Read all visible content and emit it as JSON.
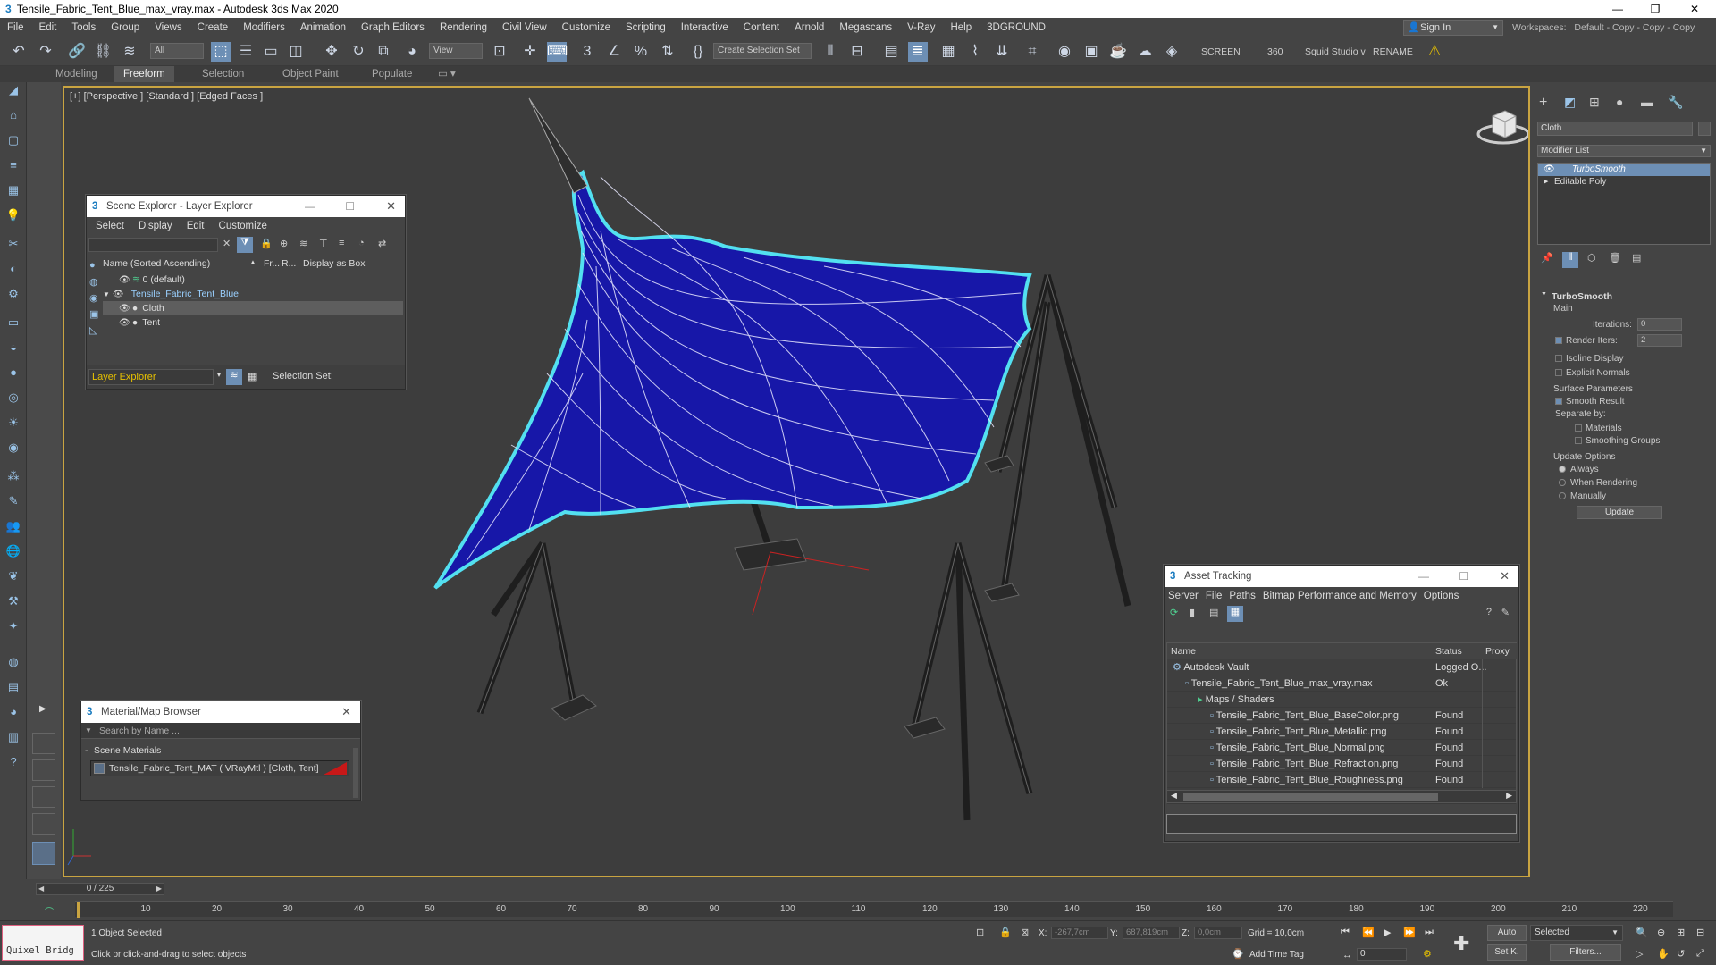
{
  "window": {
    "title": "Tensile_Fabric_Tent_Blue_max_vray.max - Autodesk 3ds Max 2020"
  },
  "menu": [
    "File",
    "Edit",
    "Tools",
    "Group",
    "Views",
    "Create",
    "Modifiers",
    "Animation",
    "Graph Editors",
    "Rendering",
    "Civil View",
    "Customize",
    "Scripting",
    "Interactive",
    "Content",
    "Arnold",
    "Megascans",
    "V-Ray",
    "Help",
    "3DGROUND"
  ],
  "signin": "Sign In",
  "workspaces": {
    "label": "Workspaces:",
    "value": "Default - Copy - Copy - Copy"
  },
  "toolbar": {
    "filter_select": "All",
    "view_select": "View",
    "selection_set": "Create Selection Set",
    "screen": "SCREEN",
    "n360": "360",
    "squid": "Squid Studio v",
    "rename": "RENAME"
  },
  "ribbon_tabs": [
    "Modeling",
    "Freeform",
    "Selection",
    "Object Paint",
    "Populate"
  ],
  "viewport": {
    "label": "[+] [Perspective ] [Standard ] [Edged Faces ]"
  },
  "scene_explorer": {
    "title": "Scene Explorer - Layer Explorer",
    "menu": [
      "Select",
      "Display",
      "Edit",
      "Customize"
    ],
    "columns": [
      "Name (Sorted Ascending)",
      "Fr...",
      "R...",
      "Display as Box"
    ],
    "rows": [
      "0 (default)",
      "Tensile_Fabric_Tent_Blue",
      "Cloth",
      "Tent"
    ],
    "footer_mode": "Layer Explorer",
    "selection_set_label": "Selection Set:"
  },
  "material_browser": {
    "title": "Material/Map Browser",
    "search_placeholder": "Search by Name ...",
    "group": "Scene Materials",
    "item": "Tensile_Fabric_Tent_MAT  ( VRayMtl )  [Cloth, Tent]"
  },
  "asset_tracking": {
    "title": "Asset Tracking",
    "menu": [
      "Server",
      "File",
      "Paths",
      "Bitmap Performance and Memory",
      "Options"
    ],
    "columns": [
      "Name",
      "Status",
      "Proxy"
    ],
    "rows": [
      {
        "name": "Autodesk Vault",
        "status": "Logged O...",
        "indent": 0
      },
      {
        "name": "Tensile_Fabric_Tent_Blue_max_vray.max",
        "status": "Ok",
        "indent": 1
      },
      {
        "name": "Maps / Shaders",
        "status": "",
        "indent": 2
      },
      {
        "name": "Tensile_Fabric_Tent_Blue_BaseColor.png",
        "status": "Found",
        "indent": 3
      },
      {
        "name": "Tensile_Fabric_Tent_Blue_Metallic.png",
        "status": "Found",
        "indent": 3
      },
      {
        "name": "Tensile_Fabric_Tent_Blue_Normal.png",
        "status": "Found",
        "indent": 3
      },
      {
        "name": "Tensile_Fabric_Tent_Blue_Refraction.png",
        "status": "Found",
        "indent": 3
      },
      {
        "name": "Tensile_Fabric_Tent_Blue_Roughness.png",
        "status": "Found",
        "indent": 3
      }
    ]
  },
  "command_panel": {
    "object_name": "Cloth",
    "modifier_list": "Modifier List",
    "stack": [
      "TurboSmooth",
      "Editable Poly"
    ],
    "rollout": "TurboSmooth",
    "main": "Main",
    "iterations_label": "Iterations:",
    "iterations": "0",
    "render_iters_label": "Render Iters:",
    "render_iters": "2",
    "isoline": "Isoline Display",
    "explicit_normals": "Explicit Normals",
    "surface_params": "Surface Parameters",
    "smooth_result": "Smooth Result",
    "separate_by": "Separate by:",
    "materials": "Materials",
    "smoothing_groups": "Smoothing Groups",
    "update_options": "Update Options",
    "always": "Always",
    "when_rendering": "When Rendering",
    "manually": "Manually",
    "update_btn": "Update"
  },
  "timeline": {
    "frame": "0 / 225",
    "ticks": [
      "10",
      "20",
      "30",
      "40",
      "50",
      "60",
      "70",
      "80",
      "90",
      "100",
      "110",
      "120",
      "130",
      "140",
      "150",
      "160",
      "170",
      "180",
      "190",
      "200",
      "210",
      "220"
    ]
  },
  "status": {
    "quixel": "Quixel Bridg",
    "selected": "1 Object Selected",
    "hint": "Click or click-and-drag to select objects",
    "x_label": "X:",
    "x": "-267,7cm",
    "y_label": "Y:",
    "y": "687,819cm",
    "z_label": "Z:",
    "z": "0,0cm",
    "grid": "Grid = 10,0cm",
    "add_time_tag": "Add Time Tag",
    "auto": "Auto",
    "selected_mode": "Selected",
    "set_k": "Set K.",
    "filters": "Filters...",
    "frame_field": "0"
  }
}
